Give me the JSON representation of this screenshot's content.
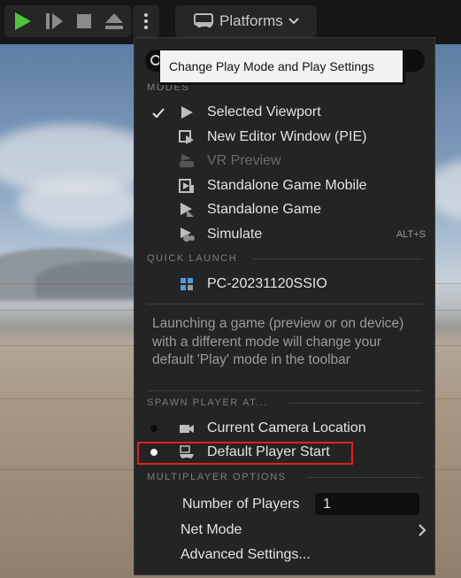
{
  "toolbar": {
    "platforms_label": "Platforms",
    "icons": [
      "play-icon",
      "advance-frame-icon",
      "stop-icon",
      "eject-icon",
      "more-options-icon",
      "gamepad-icon",
      "chevron-down-icon"
    ],
    "play_color": "#4fc43a"
  },
  "tooltip": "Change Play Mode and Play Settings",
  "sections": {
    "modes": "MODES",
    "quick_launch": "QUICK LAUNCH",
    "spawn_player_at": "SPAWN PLAYER AT...",
    "multiplayer_options": "MULTIPLAYER OPTIONS"
  },
  "modes": [
    {
      "label": "Selected Viewport",
      "checked": true,
      "icon": "play-icon"
    },
    {
      "label": "New Editor Window (PIE)",
      "icon": "editor-window-icon"
    },
    {
      "label": "VR Preview",
      "disabled": true,
      "icon": "vr-icon"
    },
    {
      "label": "Standalone Game Mobile",
      "icon": "mobile-game-icon"
    },
    {
      "label": "Standalone Game",
      "icon": "standalone-game-icon"
    },
    {
      "label": "Simulate",
      "shortcut": "ALT+S",
      "icon": "simulate-icon"
    }
  ],
  "quick_launch": [
    {
      "label": "PC-20231120SSIO",
      "icon": "windows-icon"
    }
  ],
  "description": "Launching a game (preview or on device) with a different mode will change your default 'Play' mode in the toolbar",
  "spawn": [
    {
      "label": "Current Camera Location",
      "icon": "camera-icon",
      "selected": false
    },
    {
      "label": "Default Player Start",
      "icon": "gamepad-icon",
      "selected": true
    }
  ],
  "multiplayer": {
    "num_players_label": "Number of Players",
    "num_players_value": "1",
    "net_mode_label": "Net Mode",
    "advanced_label": "Advanced Settings..."
  },
  "colors": {
    "highlight": "#e2211c",
    "menu_bg": "#242424"
  }
}
